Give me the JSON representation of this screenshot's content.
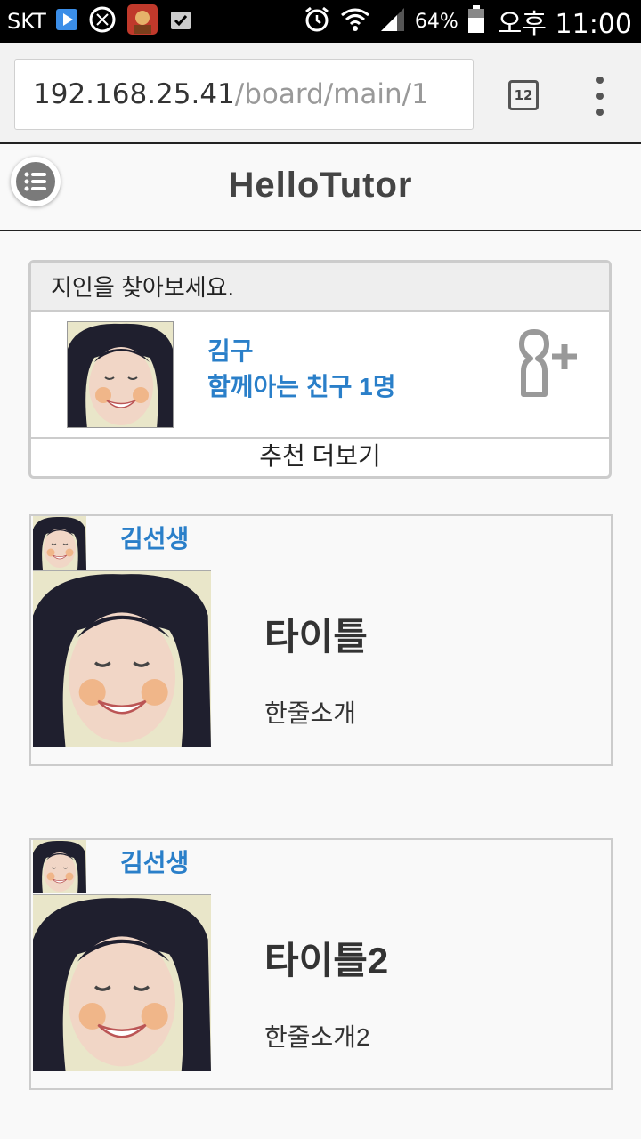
{
  "status_bar": {
    "carrier": "SKT",
    "battery": "64%",
    "time": "오후 11:00"
  },
  "browser": {
    "url_host": "192.168.25.41",
    "url_path": "/board/main/1",
    "tab_count": "12"
  },
  "app": {
    "logo": "HelloTutor"
  },
  "find_friends": {
    "header": "지인을 찾아보세요.",
    "friend_name": "김구",
    "mutual": "함께아는 친구 1명",
    "more": "추천 더보기"
  },
  "posts": [
    {
      "author": "김선생",
      "title": "타이틀",
      "intro": "한줄소개"
    },
    {
      "author": "김선생",
      "title": "타이틀2",
      "intro": "한줄소개2"
    }
  ],
  "colors": {
    "link": "#2a7fc9",
    "border": "#cccccc"
  }
}
